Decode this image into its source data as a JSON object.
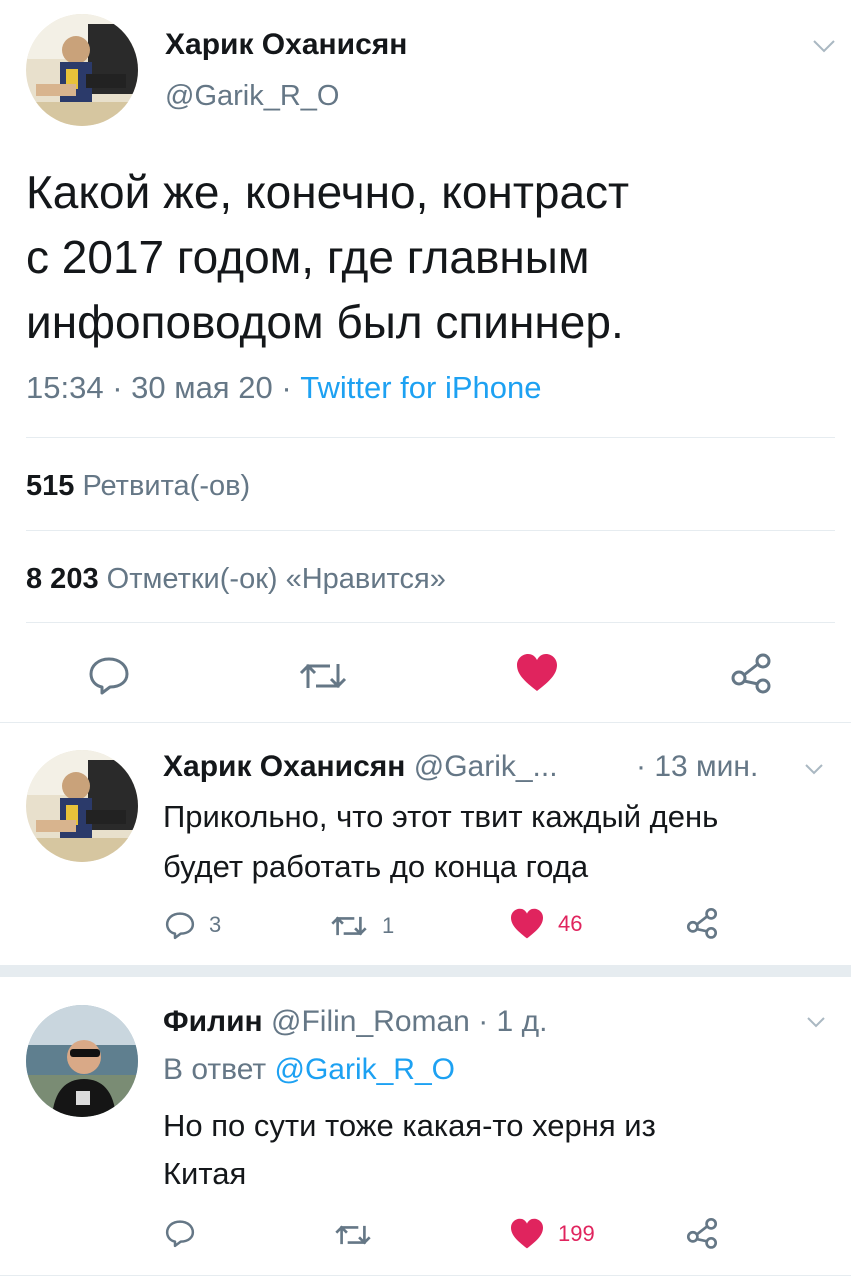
{
  "main_tweet": {
    "author_name": "Харик Оханисян",
    "author_handle": "@Garik_R_O",
    "text_lines": [
      "Какой же, конечно, контраст",
      "с 2017 годом, где главным",
      "инфоповодом был спиннер."
    ],
    "time": "15:34",
    "date": "30 мая 20",
    "separator": "·",
    "source": "Twitter for iPhone",
    "retweets_count": "515",
    "retweets_label": "Ретвита(-ов)",
    "likes_count": "8 203",
    "likes_label": "Отметки(-ок) «Нравится»"
  },
  "replies": [
    {
      "author_name": "Харик Оханисян",
      "author_handle": "@Garik_...",
      "time": "· 13 мин.",
      "text_lines": [
        "Прикольно, что этот твит каждый день",
        "будет работать до конца года"
      ],
      "replies_count": "3",
      "retweets_count": "1",
      "likes_count": "46"
    },
    {
      "author_name": "Филин",
      "author_handle": "@Filin_Roman",
      "time": "· 1 д.",
      "reply_to_label": "В ответ",
      "reply_to_handle": "@Garik_R_O",
      "text_lines": [
        "Но по сути тоже какая-то херня из",
        "Китая"
      ],
      "likes_count": "199"
    }
  ],
  "icons": [
    "reply-icon",
    "retweet-icon",
    "like-icon",
    "share-icon",
    "chevron-down-icon"
  ],
  "colors": {
    "accent": "#1da1f2",
    "like": "#e0245e",
    "muted": "#657786",
    "divider": "#e6ecf0"
  }
}
